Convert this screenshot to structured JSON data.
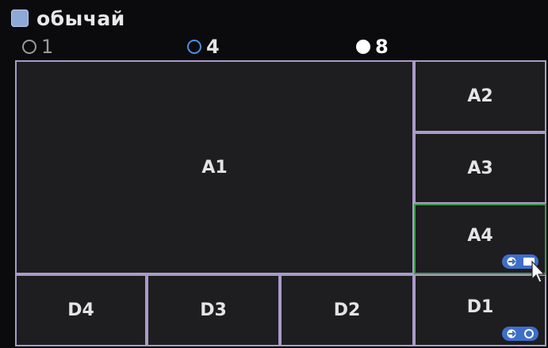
{
  "header": {
    "custom_label": "обычай",
    "custom_checked": true
  },
  "layout_modes": [
    {
      "label": "1",
      "selected": false
    },
    {
      "label": "4",
      "selected": false
    },
    {
      "label": "8",
      "selected": true
    }
  ],
  "channels": {
    "a1": "A1",
    "a2": "A2",
    "a3": "A3",
    "a4": "A4",
    "d4": "D4",
    "d3": "D3",
    "d2": "D2",
    "d1": "D1"
  },
  "active_channel": "A4",
  "icons": {
    "a4_button": [
      "arrow-right-icon",
      "screen-icon"
    ],
    "d1_button": [
      "arrow-right-icon",
      "circle-icon"
    ],
    "cursor": "mouse-pointer-icon"
  },
  "colors": {
    "cell_border": "#a99bc8",
    "active_border": "#3f9a4c",
    "button_blue": "#3d6fc8",
    "checkbox": "#8ea8d8"
  }
}
